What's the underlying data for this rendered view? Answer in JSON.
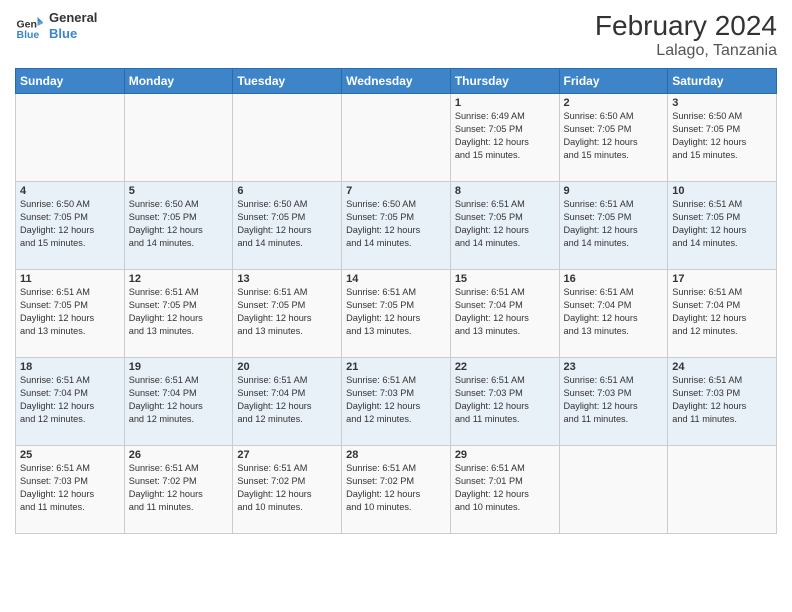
{
  "logo": {
    "line1": "General",
    "line2": "Blue"
  },
  "title": "February 2024",
  "subtitle": "Lalago, Tanzania",
  "days_of_week": [
    "Sunday",
    "Monday",
    "Tuesday",
    "Wednesday",
    "Thursday",
    "Friday",
    "Saturday"
  ],
  "weeks": [
    [
      {
        "day": "",
        "info": ""
      },
      {
        "day": "",
        "info": ""
      },
      {
        "day": "",
        "info": ""
      },
      {
        "day": "",
        "info": ""
      },
      {
        "day": "1",
        "info": "Sunrise: 6:49 AM\nSunset: 7:05 PM\nDaylight: 12 hours\nand 15 minutes."
      },
      {
        "day": "2",
        "info": "Sunrise: 6:50 AM\nSunset: 7:05 PM\nDaylight: 12 hours\nand 15 minutes."
      },
      {
        "day": "3",
        "info": "Sunrise: 6:50 AM\nSunset: 7:05 PM\nDaylight: 12 hours\nand 15 minutes."
      }
    ],
    [
      {
        "day": "4",
        "info": "Sunrise: 6:50 AM\nSunset: 7:05 PM\nDaylight: 12 hours\nand 15 minutes."
      },
      {
        "day": "5",
        "info": "Sunrise: 6:50 AM\nSunset: 7:05 PM\nDaylight: 12 hours\nand 14 minutes."
      },
      {
        "day": "6",
        "info": "Sunrise: 6:50 AM\nSunset: 7:05 PM\nDaylight: 12 hours\nand 14 minutes."
      },
      {
        "day": "7",
        "info": "Sunrise: 6:50 AM\nSunset: 7:05 PM\nDaylight: 12 hours\nand 14 minutes."
      },
      {
        "day": "8",
        "info": "Sunrise: 6:51 AM\nSunset: 7:05 PM\nDaylight: 12 hours\nand 14 minutes."
      },
      {
        "day": "9",
        "info": "Sunrise: 6:51 AM\nSunset: 7:05 PM\nDaylight: 12 hours\nand 14 minutes."
      },
      {
        "day": "10",
        "info": "Sunrise: 6:51 AM\nSunset: 7:05 PM\nDaylight: 12 hours\nand 14 minutes."
      }
    ],
    [
      {
        "day": "11",
        "info": "Sunrise: 6:51 AM\nSunset: 7:05 PM\nDaylight: 12 hours\nand 13 minutes."
      },
      {
        "day": "12",
        "info": "Sunrise: 6:51 AM\nSunset: 7:05 PM\nDaylight: 12 hours\nand 13 minutes."
      },
      {
        "day": "13",
        "info": "Sunrise: 6:51 AM\nSunset: 7:05 PM\nDaylight: 12 hours\nand 13 minutes."
      },
      {
        "day": "14",
        "info": "Sunrise: 6:51 AM\nSunset: 7:05 PM\nDaylight: 12 hours\nand 13 minutes."
      },
      {
        "day": "15",
        "info": "Sunrise: 6:51 AM\nSunset: 7:04 PM\nDaylight: 12 hours\nand 13 minutes."
      },
      {
        "day": "16",
        "info": "Sunrise: 6:51 AM\nSunset: 7:04 PM\nDaylight: 12 hours\nand 13 minutes."
      },
      {
        "day": "17",
        "info": "Sunrise: 6:51 AM\nSunset: 7:04 PM\nDaylight: 12 hours\nand 12 minutes."
      }
    ],
    [
      {
        "day": "18",
        "info": "Sunrise: 6:51 AM\nSunset: 7:04 PM\nDaylight: 12 hours\nand 12 minutes."
      },
      {
        "day": "19",
        "info": "Sunrise: 6:51 AM\nSunset: 7:04 PM\nDaylight: 12 hours\nand 12 minutes."
      },
      {
        "day": "20",
        "info": "Sunrise: 6:51 AM\nSunset: 7:04 PM\nDaylight: 12 hours\nand 12 minutes."
      },
      {
        "day": "21",
        "info": "Sunrise: 6:51 AM\nSunset: 7:03 PM\nDaylight: 12 hours\nand 12 minutes."
      },
      {
        "day": "22",
        "info": "Sunrise: 6:51 AM\nSunset: 7:03 PM\nDaylight: 12 hours\nand 11 minutes."
      },
      {
        "day": "23",
        "info": "Sunrise: 6:51 AM\nSunset: 7:03 PM\nDaylight: 12 hours\nand 11 minutes."
      },
      {
        "day": "24",
        "info": "Sunrise: 6:51 AM\nSunset: 7:03 PM\nDaylight: 12 hours\nand 11 minutes."
      }
    ],
    [
      {
        "day": "25",
        "info": "Sunrise: 6:51 AM\nSunset: 7:03 PM\nDaylight: 12 hours\nand 11 minutes."
      },
      {
        "day": "26",
        "info": "Sunrise: 6:51 AM\nSunset: 7:02 PM\nDaylight: 12 hours\nand 11 minutes."
      },
      {
        "day": "27",
        "info": "Sunrise: 6:51 AM\nSunset: 7:02 PM\nDaylight: 12 hours\nand 10 minutes."
      },
      {
        "day": "28",
        "info": "Sunrise: 6:51 AM\nSunset: 7:02 PM\nDaylight: 12 hours\nand 10 minutes."
      },
      {
        "day": "29",
        "info": "Sunrise: 6:51 AM\nSunset: 7:01 PM\nDaylight: 12 hours\nand 10 minutes."
      },
      {
        "day": "",
        "info": ""
      },
      {
        "day": "",
        "info": ""
      }
    ]
  ]
}
